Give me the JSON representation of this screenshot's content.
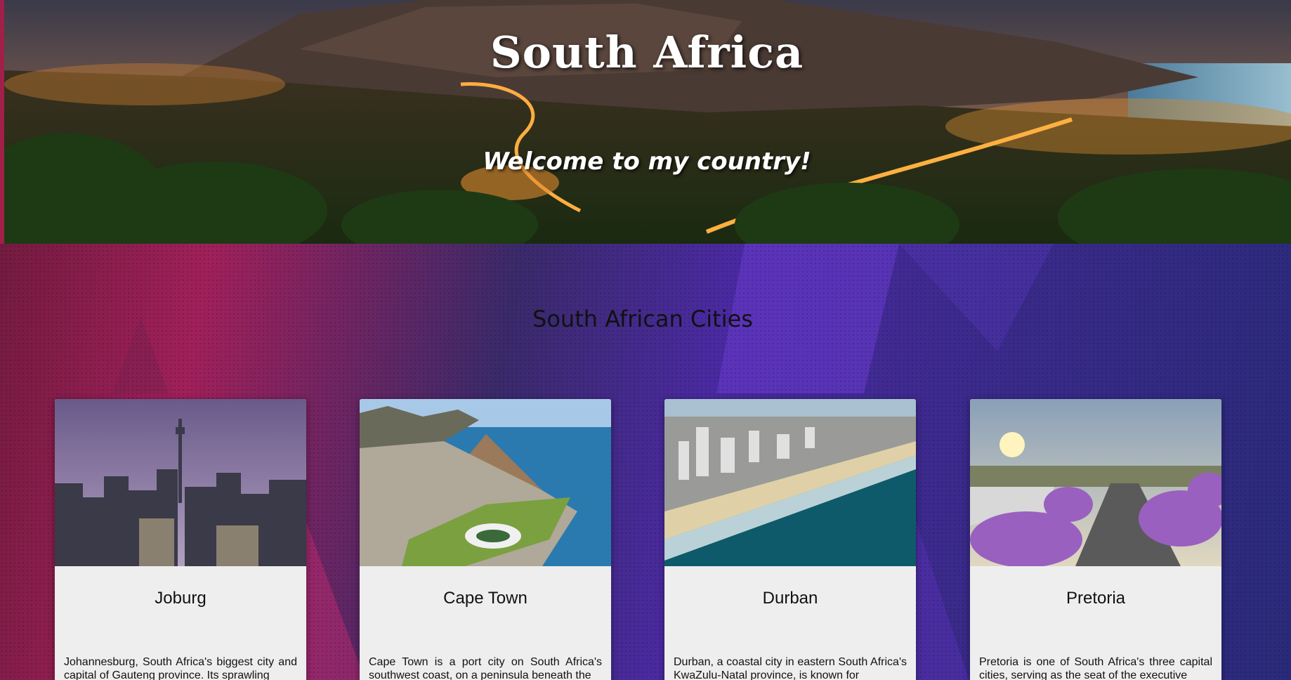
{
  "hero": {
    "title": "South Africa",
    "subtitle": "Welcome to my country!"
  },
  "section": {
    "title": "South African Cities"
  },
  "cities": [
    {
      "name": "Joburg",
      "description": "Johannesburg, South Africa's biggest city and capital of Gauteng province. Its sprawling"
    },
    {
      "name": "Cape Town",
      "description": "Cape Town is a port city on South Africa's southwest coast, on a peninsula beneath the"
    },
    {
      "name": "Durban",
      "description": "Durban, a coastal city in eastern South Africa's KwaZulu-Natal province, is known for"
    },
    {
      "name": "Pretoria",
      "description": "Pretoria is one of South Africa's three capital cities, serving as the seat of the executive"
    }
  ],
  "colors": {
    "card_background": "#eeeeee",
    "gradient_left": "#a0205a",
    "gradient_right": "#4a2aa0"
  }
}
